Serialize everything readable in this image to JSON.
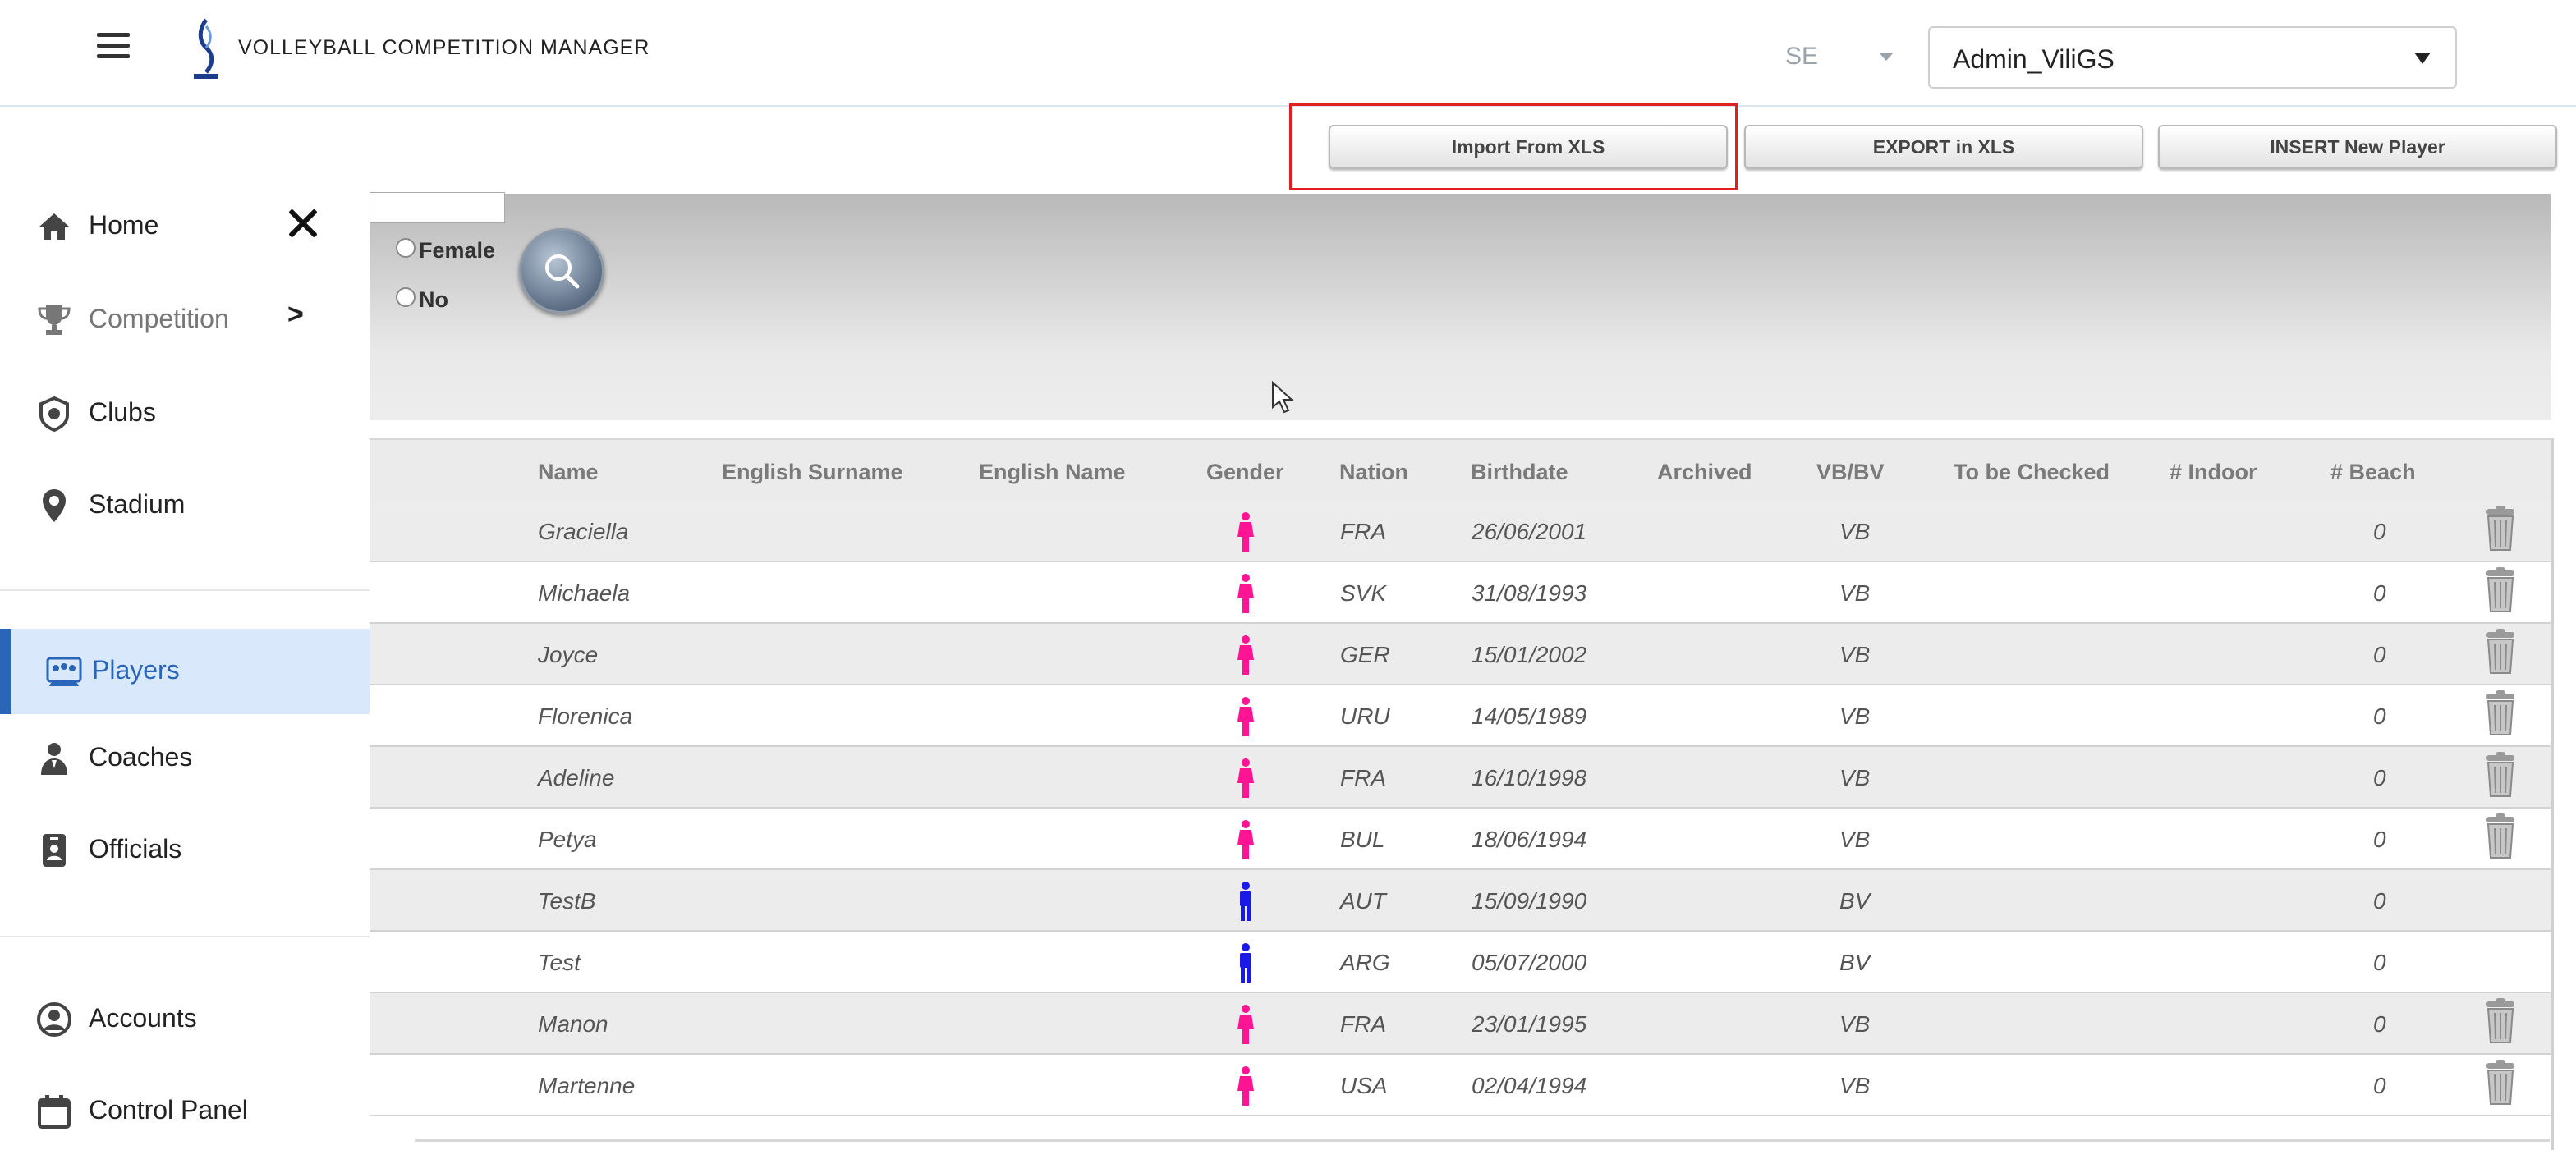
{
  "header": {
    "title": "VOLLEYBALL COMPETITION MANAGER",
    "language": "SE",
    "user": "Admin_ViliGS"
  },
  "toolbar": {
    "import_label": "Import From XLS",
    "export_label": "EXPORT in XLS",
    "insert_label": "INSERT New Player"
  },
  "filters": {
    "gender_option": "Female",
    "archived_option": "No"
  },
  "sidebar": {
    "items": [
      {
        "label": "Home",
        "icon": "home-icon"
      },
      {
        "label": "Competition",
        "icon": "trophy-icon",
        "arrow": ">"
      },
      {
        "label": "Clubs",
        "icon": "club-badge-icon"
      },
      {
        "label": "Stadium",
        "icon": "location-pin-icon"
      },
      {
        "label": "Players",
        "icon": "players-icon",
        "active": true
      },
      {
        "label": "Coaches",
        "icon": "coach-icon"
      },
      {
        "label": "Officials",
        "icon": "id-badge-icon"
      },
      {
        "label": "Accounts",
        "icon": "account-icon"
      },
      {
        "label": "Control Panel",
        "icon": "calendar-icon"
      }
    ]
  },
  "table": {
    "columns": [
      "Name",
      "English Surname",
      "English Name",
      "Gender",
      "Nation",
      "Birthdate",
      "Archived",
      "VB/BV",
      "To be Checked",
      "# Indoor",
      "# Beach"
    ],
    "rows": [
      {
        "name": "Graciella",
        "gender": "female",
        "nation": "FRA",
        "birthdate": "26/06/2001",
        "vbbv": "VB",
        "beach": "0",
        "delete": true
      },
      {
        "name": "Michaela",
        "gender": "female",
        "nation": "SVK",
        "birthdate": "31/08/1993",
        "vbbv": "VB",
        "beach": "0",
        "delete": true
      },
      {
        "name": "Joyce",
        "gender": "female",
        "nation": "GER",
        "birthdate": "15/01/2002",
        "vbbv": "VB",
        "beach": "0",
        "delete": true
      },
      {
        "name": "Florenica",
        "gender": "female",
        "nation": "URU",
        "birthdate": "14/05/1989",
        "vbbv": "VB",
        "beach": "0",
        "delete": true
      },
      {
        "name": "Adeline",
        "gender": "female",
        "nation": "FRA",
        "birthdate": "16/10/1998",
        "vbbv": "VB",
        "beach": "0",
        "delete": true
      },
      {
        "name": "Petya",
        "gender": "female",
        "nation": "BUL",
        "birthdate": "18/06/1994",
        "vbbv": "VB",
        "beach": "0",
        "delete": true
      },
      {
        "name": "TestB",
        "gender": "male",
        "nation": "AUT",
        "birthdate": "15/09/1990",
        "vbbv": "BV",
        "beach": "0",
        "delete": false
      },
      {
        "name": "Test",
        "gender": "male",
        "nation": "ARG",
        "birthdate": "05/07/2000",
        "vbbv": "BV",
        "beach": "0",
        "delete": false
      },
      {
        "name": "Manon",
        "gender": "female",
        "nation": "FRA",
        "birthdate": "23/01/1995",
        "vbbv": "VB",
        "beach": "0",
        "delete": true
      },
      {
        "name": "Martenne",
        "gender": "female",
        "nation": "USA",
        "birthdate": "02/04/1994",
        "vbbv": "VB",
        "beach": "0",
        "delete": true
      }
    ]
  },
  "colors": {
    "female": "#ff1493",
    "male": "#1a1ae6",
    "accent": "#2a65b8",
    "highlight": "#e02020"
  }
}
